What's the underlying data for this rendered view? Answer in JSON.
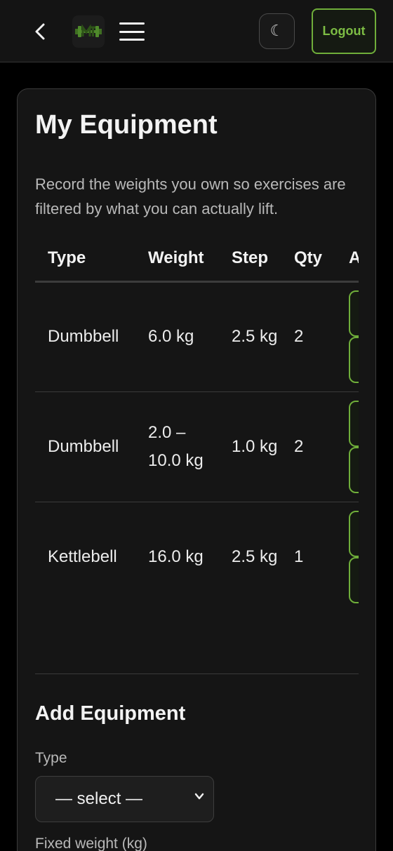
{
  "navbar": {
    "theme_toggle_glyph": "☾",
    "logout_label": "Logout",
    "accent_color": "#6fae3a"
  },
  "page": {
    "title": "My Equipment",
    "description": "Record the weights you own so exercises are filtered by what you can actually lift."
  },
  "table": {
    "headers": [
      "Type",
      "Weight",
      "Step",
      "Qty",
      "Actions"
    ],
    "rows": [
      {
        "type": "Dumbbell",
        "weight": "6.0 kg",
        "step": "2.5 kg",
        "qty": "2"
      },
      {
        "type": "Dumbbell",
        "weight": "2.0 – 10.0 kg",
        "step": "1.0 kg",
        "qty": "2"
      },
      {
        "type": "Kettlebell",
        "weight": "16.0 kg",
        "step": "2.5 kg",
        "qty": "1"
      }
    ]
  },
  "add_form": {
    "title": "Add Equipment",
    "type_label": "Type",
    "type_selected": "— select —",
    "fixed_weight_label": "Fixed weight (kg)"
  }
}
